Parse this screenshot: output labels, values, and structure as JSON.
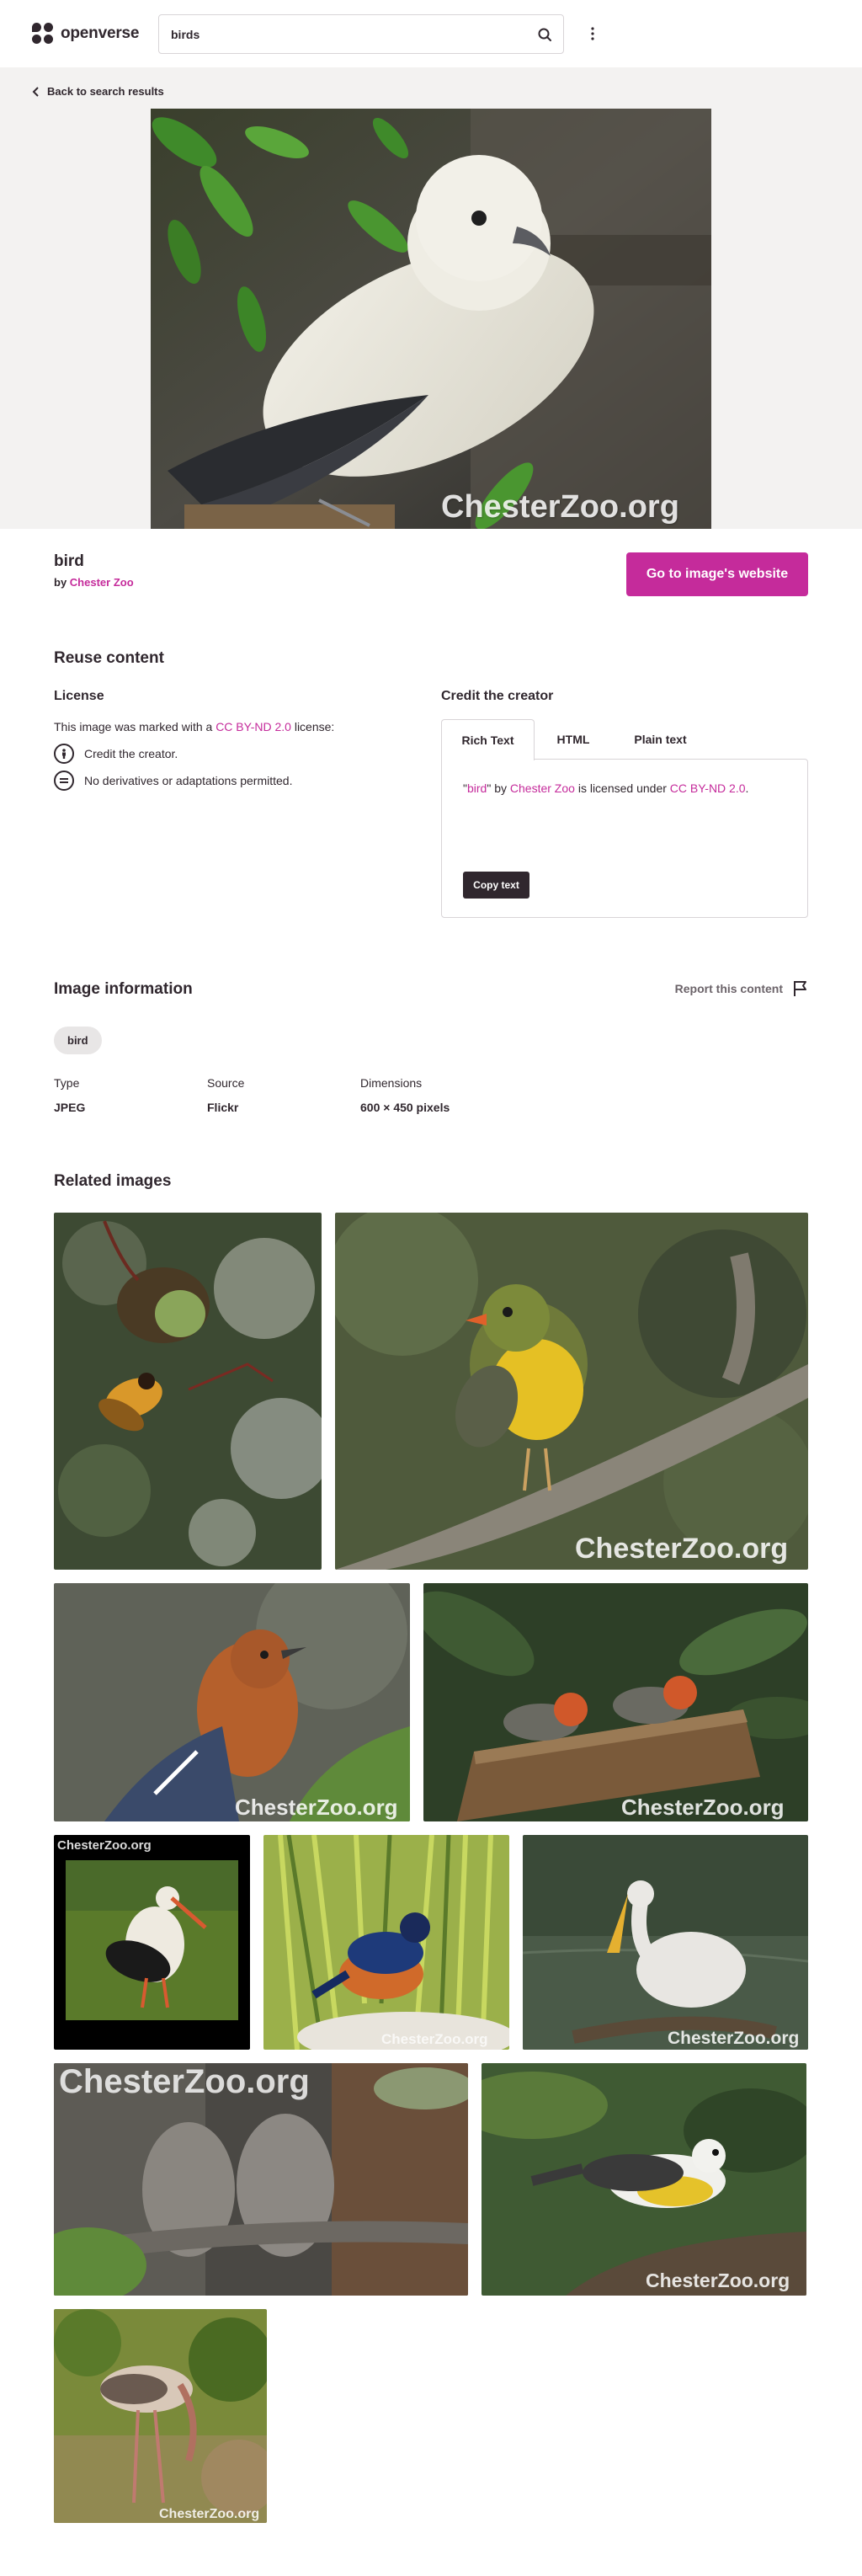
{
  "header": {
    "logo_text": "openverse",
    "search_value": "birds"
  },
  "hero": {
    "back_label": "Back to search results",
    "watermark": "ChesterZoo.org"
  },
  "image": {
    "title": "bird",
    "by_prefix": "by ",
    "creator": "Chester Zoo",
    "go_button": "Go to image's website"
  },
  "reuse": {
    "heading": "Reuse content",
    "license_heading": "License",
    "license_prefix": "This image was marked with a ",
    "license_name": "CC BY-ND 2.0",
    "license_suffix": " license:",
    "items": [
      {
        "icon": "cc-by-icon",
        "text": "Credit the creator."
      },
      {
        "icon": "cc-nd-icon",
        "text": "No derivatives or adaptations permitted."
      }
    ],
    "credit_heading": "Credit the creator",
    "tabs": [
      "Rich Text",
      "HTML",
      "Plain text"
    ],
    "active_tab": "Rich Text",
    "credit": {
      "q_open": "\"",
      "title": "bird",
      "q_close": "\" by ",
      "creator": "Chester Zoo",
      "mid": " is licensed under ",
      "license": "CC BY-ND 2.0",
      "end": "."
    },
    "copy_button": "Copy text"
  },
  "info": {
    "heading": "Image information",
    "report_label": "Report this content",
    "tags": [
      "bird"
    ],
    "meta": [
      {
        "label": "Type",
        "value": "JPEG"
      },
      {
        "label": "Source",
        "value": "Flickr"
      },
      {
        "label": "Dimensions",
        "value": "600 × 450 pixels"
      }
    ]
  },
  "related": {
    "heading": "Related images",
    "watermark": "ChesterZoo.org"
  },
  "colors": {
    "accent": "#c52b9b",
    "text": "#30272e",
    "hero_bg": "#f3f2f1"
  }
}
